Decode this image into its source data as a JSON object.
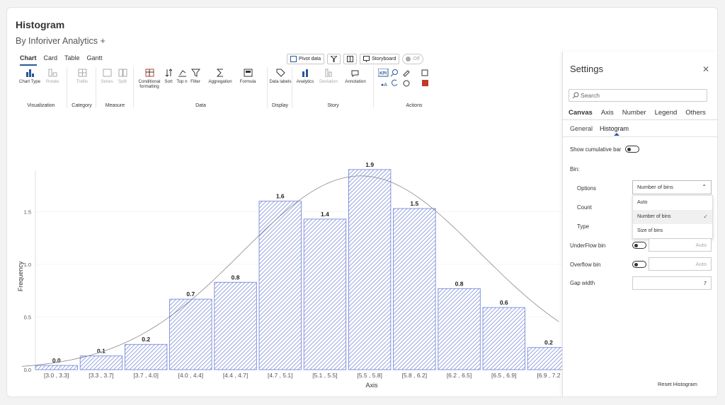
{
  "header": {
    "title": "Histogram",
    "subtitle": "By Inforiver Analytics +"
  },
  "ribbon": {
    "tabs": [
      "Chart",
      "Card",
      "Table",
      "Gantt"
    ],
    "active_tab": "Chart",
    "groups": [
      {
        "label": "Visualization",
        "buttons": [
          "Chart Type",
          "Rotate"
        ]
      },
      {
        "label": "Category",
        "buttons": [
          "Trellis"
        ]
      },
      {
        "label": "Measure",
        "buttons": [
          "Series",
          "Split"
        ]
      },
      {
        "label": "Data",
        "buttons": [
          "Conditional formatting",
          "Sort",
          "Top n",
          "Filter",
          "Aggregation",
          "Formula"
        ]
      },
      {
        "label": "Display",
        "buttons": [
          "Data labels"
        ]
      },
      {
        "label": "Story",
        "buttons": [
          "Analytics",
          "Deviation",
          "Annotation"
        ]
      },
      {
        "label": "Actions",
        "buttons": []
      }
    ],
    "pivot_label": "Pivot data",
    "storyboard_label": "Storyboard",
    "toggle_label": "Off"
  },
  "settings": {
    "title": "Settings",
    "search_placeholder": "Search",
    "tabs": [
      "Canvas",
      "Axis",
      "Number",
      "Legend",
      "Others"
    ],
    "active_tab": "Canvas",
    "subtabs": [
      "General",
      "Histogram"
    ],
    "active_subtab": "Histogram",
    "show_cumulative_label": "Show cumulative bar",
    "bin_label": "Bin:",
    "options_label": "Options",
    "options_value": "Number of bins",
    "count_label": "Count",
    "type_label": "Type",
    "dropdown_options": [
      "Auto",
      "Number of bins",
      "Size of bins"
    ],
    "underflow_label": "UnderFlow bin",
    "overflow_label": "Overflow bin",
    "auto_text": "Auto",
    "gap_label": "Gap width",
    "gap_value": "7",
    "reset_label": "Reset Histogram"
  },
  "chart_data": {
    "type": "bar",
    "categories": [
      "[3.0 , 3.3]",
      "[3.3 , 3.7]",
      "[3.7 , 4.0]",
      "[4.0 , 4.4]",
      "[4.4 , 4.7]",
      "[4.7 , 5.1]",
      "[5.1 , 5.5]",
      "[5.5 , 5.8]",
      "[5.8 , 6.2]",
      "[6.2 , 6.5]",
      "[6.5 , 6.9]",
      "[6.9 , 7.2"
    ],
    "values": [
      0.04,
      0.13,
      0.24,
      0.67,
      0.83,
      1.6,
      1.43,
      1.9,
      1.53,
      0.77,
      0.59,
      0.21
    ],
    "data_labels": [
      "0.0",
      "0.1",
      "0.2",
      "0.7",
      "0.8",
      "1.6",
      "1.4",
      "1.9",
      "1.5",
      "0.8",
      "0.6",
      "0.2"
    ],
    "xlabel": "Axis",
    "ylabel": "Frequency",
    "yticks": [
      0.0,
      0.5,
      1.0,
      1.5
    ],
    "ytick_labels": [
      "0.0",
      "0.5",
      "1.0",
      "1.5"
    ],
    "ylim": [
      0,
      1.9
    ],
    "bar_color": "#6b7fd7",
    "curve_color": "#888888"
  }
}
